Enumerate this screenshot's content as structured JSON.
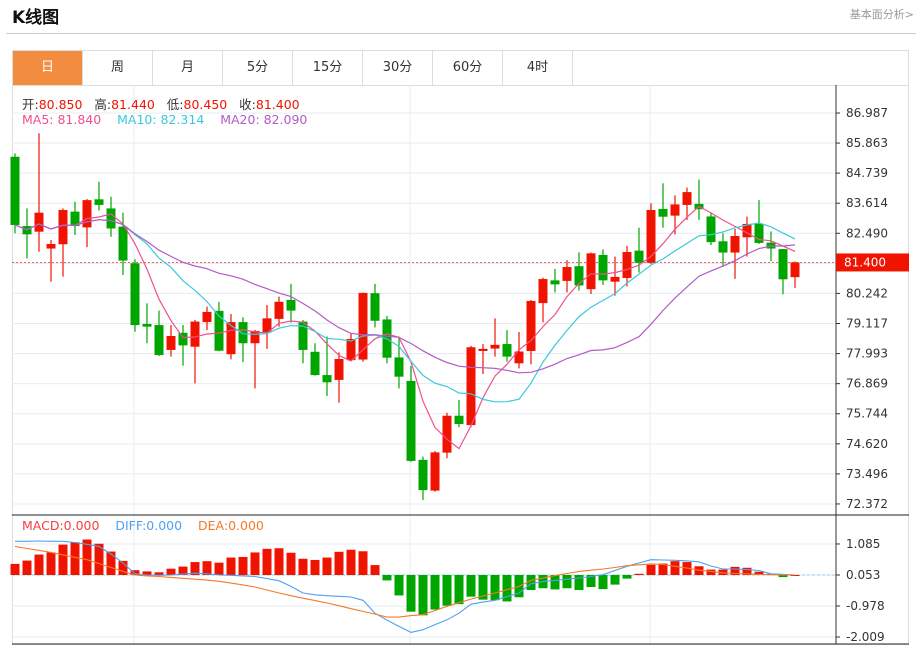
{
  "header": {
    "title": "K线图",
    "link": "基本面分析>"
  },
  "tabs": [
    {
      "label": "日",
      "active": true
    },
    {
      "label": "周"
    },
    {
      "label": "月"
    },
    {
      "label": "5分"
    },
    {
      "label": "15分"
    },
    {
      "label": "30分"
    },
    {
      "label": "60分"
    },
    {
      "label": "4时"
    }
  ],
  "ohlc_legend": {
    "open_label": "开:",
    "open": "80.850",
    "high_label": "高:",
    "high": "81.440",
    "low_label": "低:",
    "low": "80.450",
    "close_label": "收:",
    "close": "81.400"
  },
  "ma_legend": {
    "ma5": "MA5: 81.840",
    "ma10": "MA10: 82.314",
    "ma20": "MA20: 82.090"
  },
  "macd_legend": {
    "macd": "MACD:0.000",
    "diff": "DIFF:0.000",
    "dea": "DEA:0.000"
  },
  "colors": {
    "up": "#f01400",
    "down": "#00a600",
    "ma5": "#f0508c",
    "ma10": "#3cc8dc",
    "ma20": "#b45ac8",
    "diff": "#50a0f0",
    "dea": "#f57a28",
    "accent": "#f28c3e"
  },
  "chart_data": {
    "type": "candlestick",
    "price_ticks": [
      "86.987",
      "85.863",
      "84.739",
      "83.614",
      "82.490",
      "81.400",
      "80.242",
      "79.117",
      "77.993",
      "76.869",
      "75.744",
      "74.620",
      "73.496",
      "72.372"
    ],
    "tick_values": [
      86.987,
      85.863,
      84.739,
      83.614,
      82.49,
      81.366,
      80.242,
      79.117,
      77.993,
      76.869,
      75.744,
      74.62,
      73.496,
      72.372
    ],
    "last_price": "81.400",
    "macd_ticks": [
      "1.085",
      "0.053",
      "-0.978",
      "-2.009"
    ],
    "macd_tick_values": [
      1.085,
      0.053,
      -0.978,
      -2.009
    ],
    "candles": [
      [
        85.35,
        82.8,
        85.48,
        82.49
      ],
      [
        82.76,
        82.45,
        83.42,
        81.55
      ],
      [
        82.55,
        83.26,
        86.23,
        81.8
      ],
      [
        81.92,
        82.09,
        82.24,
        80.68
      ],
      [
        82.08,
        83.36,
        83.42,
        80.87
      ],
      [
        83.3,
        82.76,
        83.67,
        82.43
      ],
      [
        82.71,
        83.73,
        83.77,
        81.97
      ],
      [
        83.76,
        83.55,
        84.42,
        83.34
      ],
      [
        83.42,
        82.67,
        83.86,
        82.36
      ],
      [
        82.74,
        81.47,
        83.26,
        80.93
      ],
      [
        81.37,
        79.06,
        81.52,
        78.81
      ],
      [
        79.1,
        79.0,
        79.87,
        78.38
      ],
      [
        79.06,
        77.94,
        79.6,
        77.9
      ],
      [
        78.13,
        78.65,
        79.06,
        77.88
      ],
      [
        78.77,
        78.3,
        79.06,
        77.54
      ],
      [
        78.25,
        79.19,
        79.25,
        76.88
      ],
      [
        79.17,
        79.55,
        79.75,
        78.87
      ],
      [
        79.59,
        78.1,
        79.93,
        78.08
      ],
      [
        77.97,
        79.17,
        79.47,
        77.78
      ],
      [
        79.17,
        78.38,
        79.35,
        77.67
      ],
      [
        78.38,
        78.84,
        78.88,
        76.69
      ],
      [
        78.79,
        79.31,
        79.81,
        78.17
      ],
      [
        79.29,
        79.93,
        80.12,
        79.0
      ],
      [
        80.0,
        79.6,
        80.6,
        79.15
      ],
      [
        79.19,
        78.13,
        79.25,
        77.63
      ],
      [
        78.06,
        77.19,
        78.38,
        77.17
      ],
      [
        77.19,
        76.92,
        78.63,
        76.41
      ],
      [
        77.01,
        77.79,
        78.04,
        76.16
      ],
      [
        77.75,
        78.54,
        78.75,
        77.73
      ],
      [
        77.77,
        80.26,
        80.28,
        77.69
      ],
      [
        80.25,
        79.22,
        80.6,
        78.97
      ],
      [
        79.27,
        77.84,
        79.4,
        77.63
      ],
      [
        77.85,
        77.13,
        78.63,
        76.69
      ],
      [
        76.97,
        73.98,
        77.53,
        73.95
      ],
      [
        74.02,
        72.89,
        74.14,
        72.52
      ],
      [
        72.87,
        74.3,
        74.35,
        72.83
      ],
      [
        74.29,
        75.67,
        75.78,
        74.08
      ],
      [
        75.67,
        75.36,
        76.26,
        75.24
      ],
      [
        75.32,
        78.23,
        78.28,
        75.24
      ],
      [
        78.09,
        78.17,
        78.35,
        77.23
      ],
      [
        78.18,
        78.32,
        79.31,
        77.88
      ],
      [
        78.35,
        77.88,
        78.87,
        77.69
      ],
      [
        77.63,
        78.07,
        78.8,
        77.44
      ],
      [
        78.09,
        79.96,
        80.0,
        77.59
      ],
      [
        79.88,
        80.78,
        80.83,
        79.16
      ],
      [
        80.73,
        80.58,
        81.16,
        80.28
      ],
      [
        80.71,
        81.23,
        81.49,
        80.28
      ],
      [
        81.26,
        80.54,
        81.78,
        80.35
      ],
      [
        80.4,
        81.74,
        81.77,
        80.22
      ],
      [
        81.68,
        80.73,
        81.89,
        80.56
      ],
      [
        80.68,
        80.86,
        81.62,
        80.16
      ],
      [
        80.82,
        81.79,
        82.02,
        80.5
      ],
      [
        81.84,
        81.39,
        82.7,
        81.02
      ],
      [
        81.39,
        83.36,
        83.61,
        81.34
      ],
      [
        83.4,
        83.11,
        84.36,
        82.7
      ],
      [
        83.15,
        83.57,
        83.91,
        82.45
      ],
      [
        83.55,
        84.03,
        84.2,
        82.99
      ],
      [
        83.59,
        83.39,
        84.5,
        82.99
      ],
      [
        83.12,
        82.16,
        83.26,
        82.05
      ],
      [
        82.19,
        81.77,
        82.49,
        81.24
      ],
      [
        81.77,
        82.39,
        82.65,
        80.79
      ],
      [
        82.34,
        82.84,
        83.11,
        81.62
      ],
      [
        82.85,
        82.13,
        83.73,
        82.09
      ],
      [
        82.14,
        81.92,
        82.56,
        81.45
      ],
      [
        81.9,
        80.77,
        81.9,
        80.21
      ],
      [
        80.85,
        81.4,
        81.44,
        80.45
      ]
    ],
    "macd_hist": [
      0.37,
      0.48,
      0.68,
      0.75,
      1.01,
      1.09,
      1.18,
      1.04,
      0.78,
      0.47,
      0.16,
      0.12,
      0.09,
      0.21,
      0.28,
      0.43,
      0.46,
      0.41,
      0.58,
      0.6,
      0.75,
      0.87,
      0.89,
      0.74,
      0.54,
      0.5,
      0.58,
      0.77,
      0.84,
      0.79,
      0.33,
      -0.18,
      -0.68,
      -1.22,
      -1.34,
      -1.15,
      -1.02,
      -0.97,
      -0.72,
      -0.82,
      -0.84,
      -0.88,
      -0.74,
      -0.5,
      -0.44,
      -0.48,
      -0.44,
      -0.5,
      -0.4,
      -0.47,
      -0.32,
      -0.12,
      0.04,
      0.34,
      0.38,
      0.46,
      0.43,
      0.29,
      0.18,
      0.18,
      0.27,
      0.24,
      0.11,
      0.04,
      -0.07,
      0.0
    ],
    "diff": [
      1.12,
      1.12,
      1.13,
      1.12,
      1.12,
      1.08,
      1.02,
      0.95,
      0.7,
      0.4,
      0.04,
      0.0,
      -0.01,
      0.0,
      0.03,
      0.06,
      0.04,
      0.0,
      -0.01,
      -0.03,
      -0.05,
      -0.12,
      -0.19,
      -0.38,
      -0.6,
      -0.66,
      -0.69,
      -0.71,
      -0.73,
      -0.84,
      -1.27,
      -1.5,
      -1.71,
      -1.91,
      -1.82,
      -1.65,
      -1.49,
      -1.27,
      -0.97,
      -0.9,
      -0.84,
      -0.72,
      -0.6,
      -0.29,
      -0.22,
      -0.18,
      -0.14,
      -0.1,
      -0.05,
      0.01,
      0.15,
      0.29,
      0.4,
      0.51,
      0.5,
      0.49,
      0.47,
      0.44,
      0.3,
      0.2,
      0.2,
      0.18,
      0.15,
      0.04,
      0.02,
      0.0
    ],
    "dea": [
      0.95,
      0.88,
      0.82,
      0.75,
      0.67,
      0.59,
      0.51,
      0.38,
      0.25,
      0.12,
      0.0,
      -0.03,
      -0.05,
      -0.08,
      -0.11,
      -0.14,
      -0.17,
      -0.21,
      -0.27,
      -0.33,
      -0.4,
      -0.5,
      -0.6,
      -0.69,
      -0.77,
      -0.85,
      -0.93,
      -1.02,
      -1.12,
      -1.21,
      -1.3,
      -1.4,
      -1.4,
      -1.35,
      -1.32,
      -1.18,
      -1.04,
      -0.92,
      -0.8,
      -0.7,
      -0.6,
      -0.49,
      -0.38,
      -0.18,
      -0.1,
      -0.02,
      0.05,
      0.12,
      0.16,
      0.2,
      0.25,
      0.31,
      0.34,
      0.37,
      0.35,
      0.29,
      0.23,
      0.16,
      0.12,
      0.07,
      0.05,
      0.04,
      0.02,
      0.01,
      0.0,
      0.0
    ]
  }
}
